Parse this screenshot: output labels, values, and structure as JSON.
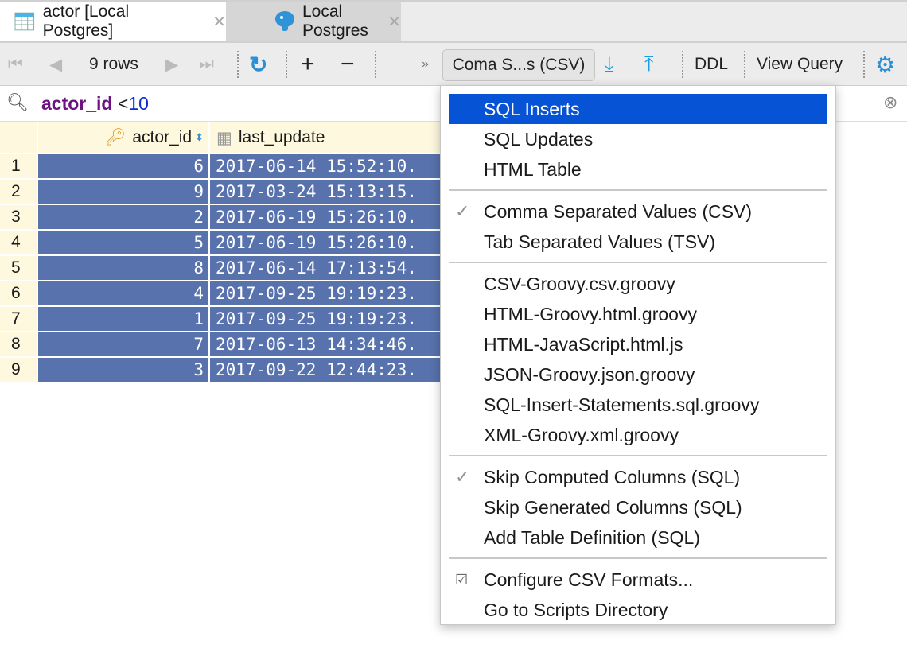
{
  "tabs": [
    {
      "label": "actor [Local Postgres]",
      "icon": "table-icon",
      "active": true
    },
    {
      "label": "Local Postgres",
      "icon": "postgres-elephant-icon",
      "active": false
    }
  ],
  "toolbar": {
    "rows_label": "9 rows",
    "format_label": "Coma S...s (CSV)",
    "ddl_label": "DDL",
    "view_query_label": "View Query",
    "more": "»"
  },
  "filter": {
    "column": "actor_id",
    "operator": "<",
    "value": "10"
  },
  "table": {
    "columns": [
      "actor_id",
      "last_update"
    ],
    "rows": [
      {
        "n": "1",
        "actor_id": "6",
        "last_update": "2017-06-14 15:52:10."
      },
      {
        "n": "2",
        "actor_id": "9",
        "last_update": "2017-03-24 15:13:15."
      },
      {
        "n": "3",
        "actor_id": "2",
        "last_update": "2017-06-19 15:26:10."
      },
      {
        "n": "4",
        "actor_id": "5",
        "last_update": "2017-06-19 15:26:10."
      },
      {
        "n": "5",
        "actor_id": "8",
        "last_update": "2017-06-14 17:13:54."
      },
      {
        "n": "6",
        "actor_id": "4",
        "last_update": "2017-09-25 19:19:23."
      },
      {
        "n": "7",
        "actor_id": "1",
        "last_update": "2017-09-25 19:19:23."
      },
      {
        "n": "8",
        "actor_id": "7",
        "last_update": "2017-06-13 14:34:46."
      },
      {
        "n": "9",
        "actor_id": "3",
        "last_update": "2017-09-22 12:44:23."
      }
    ]
  },
  "menu": {
    "groups": [
      [
        {
          "label": "SQL Inserts",
          "highlighted": true
        },
        {
          "label": "SQL Updates"
        },
        {
          "label": "HTML Table"
        }
      ],
      [
        {
          "label": "Comma Separated Values (CSV)",
          "checked": true
        },
        {
          "label": "Tab Separated Values (TSV)"
        }
      ],
      [
        {
          "label": "CSV-Groovy.csv.groovy"
        },
        {
          "label": "HTML-Groovy.html.groovy"
        },
        {
          "label": "HTML-JavaScript.html.js"
        },
        {
          "label": "JSON-Groovy.json.groovy"
        },
        {
          "label": "SQL-Insert-Statements.sql.groovy"
        },
        {
          "label": "XML-Groovy.xml.groovy"
        }
      ],
      [
        {
          "label": "Skip Computed Columns (SQL)",
          "checked": true
        },
        {
          "label": "Skip Generated Columns (SQL)"
        },
        {
          "label": "Add Table Definition (SQL)"
        }
      ],
      [
        {
          "label": "Configure CSV Formats...",
          "icon": "checklist-icon"
        },
        {
          "label": "Go to Scripts Directory"
        }
      ]
    ]
  },
  "colors": {
    "selection": "#5872ad",
    "highlight": "#0753d6",
    "header": "#fdf8de",
    "accent": "#2a8fd4"
  }
}
